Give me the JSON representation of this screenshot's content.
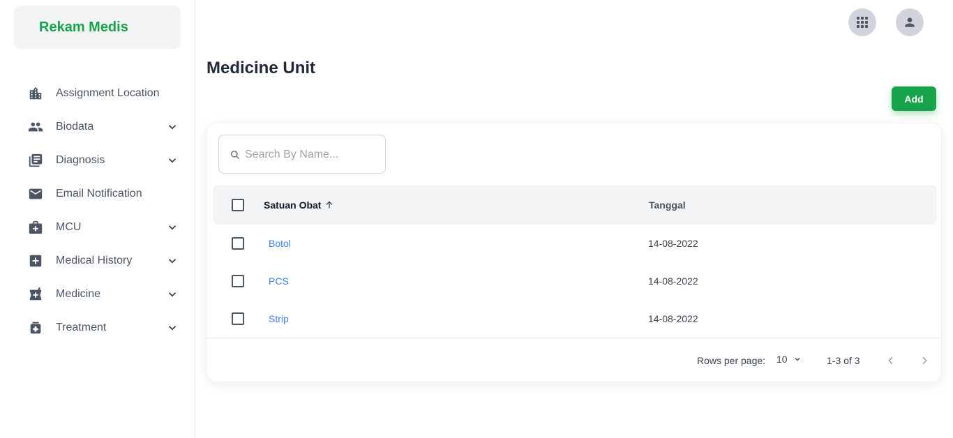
{
  "brand": {
    "title": "Rekam Medis",
    "color": "#16a34a"
  },
  "sidebar": {
    "items": [
      {
        "label": "Assignment Location",
        "icon": "building-icon",
        "expandable": false
      },
      {
        "label": "Biodata",
        "icon": "people-icon",
        "expandable": true
      },
      {
        "label": "Diagnosis",
        "icon": "document-list-icon",
        "expandable": true
      },
      {
        "label": "Email Notification",
        "icon": "mail-icon",
        "expandable": false
      },
      {
        "label": "MCU",
        "icon": "medical-bag-icon",
        "expandable": true
      },
      {
        "label": "Medical History",
        "icon": "medical-plus-icon",
        "expandable": true
      },
      {
        "label": "Medicine",
        "icon": "pharmacy-icon",
        "expandable": true
      },
      {
        "label": "Treatment",
        "icon": "medication-icon",
        "expandable": true
      }
    ]
  },
  "header": {
    "apps_icon": "apps-grid-icon",
    "user_icon": "user-avatar-icon"
  },
  "page": {
    "title": "Medicine Unit",
    "add_label": "Add"
  },
  "search": {
    "placeholder": "Search By Name..."
  },
  "table": {
    "columns": [
      {
        "label": "Satuan Obat",
        "sorted": "ascending"
      },
      {
        "label": "Tanggal"
      }
    ],
    "rows": [
      {
        "unit": "Botol",
        "date": "14-08-2022"
      },
      {
        "unit": "PCS",
        "date": "14-08-2022"
      },
      {
        "unit": "Strip",
        "date": "14-08-2022"
      }
    ]
  },
  "pagination": {
    "rows_per_page_label": "Rows per page:",
    "rows_per_page": "10",
    "range": "1-3 of 3"
  }
}
